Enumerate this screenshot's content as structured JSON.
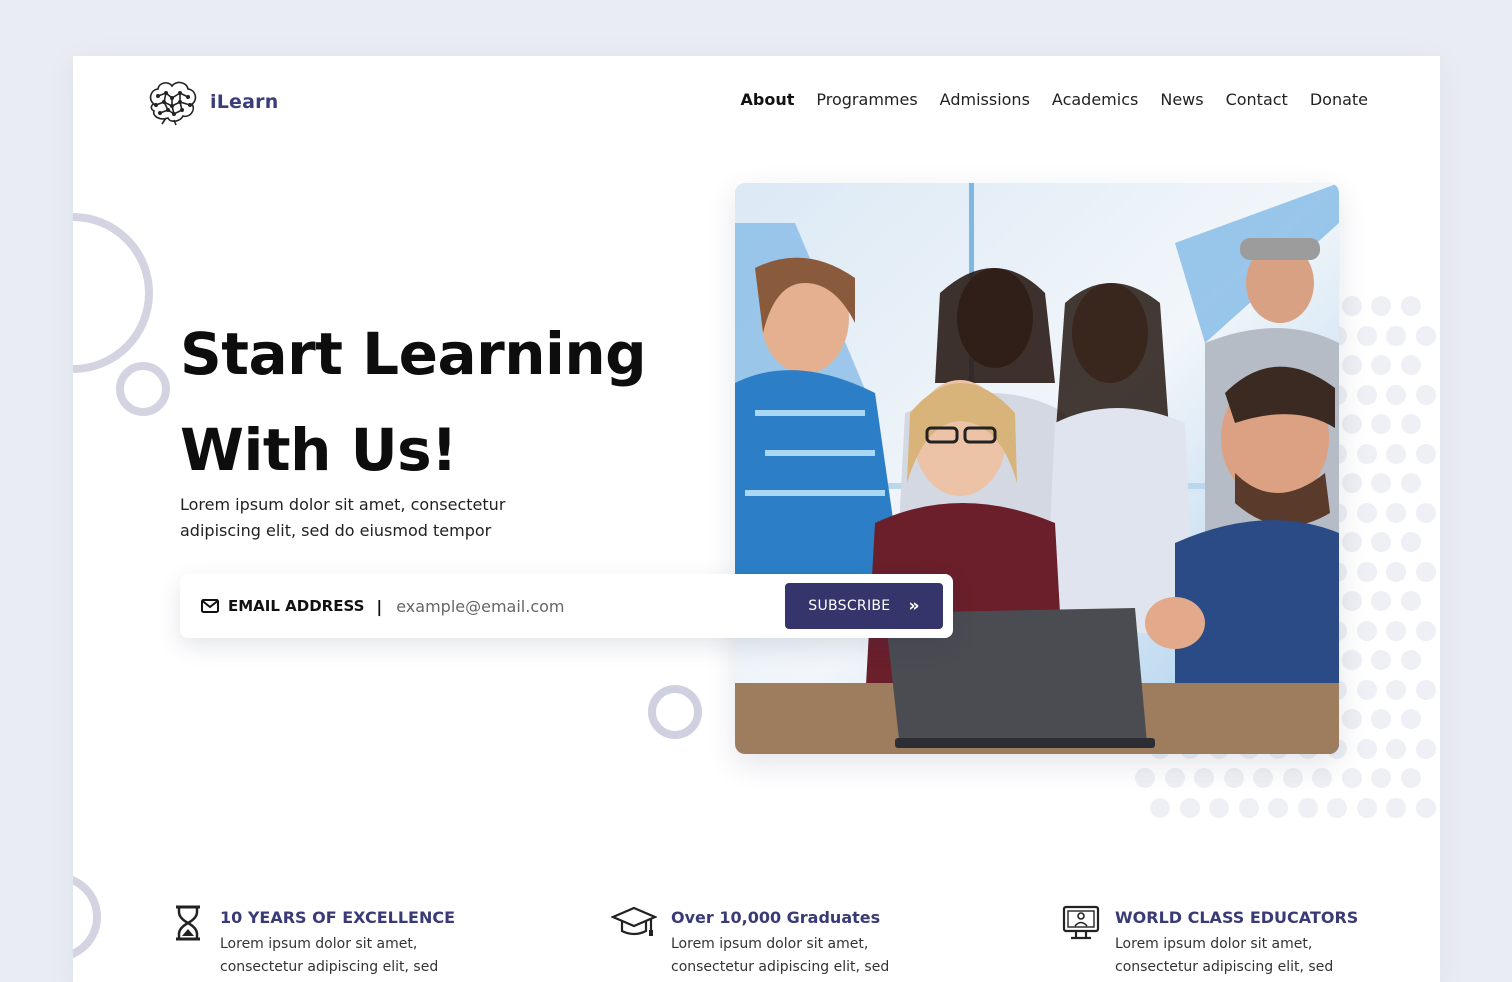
{
  "brand": {
    "name": "iLearn",
    "color": "#3b3c7a"
  },
  "nav": {
    "items": [
      {
        "label": "About",
        "active": true
      },
      {
        "label": "Programmes"
      },
      {
        "label": "Admissions"
      },
      {
        "label": "Academics"
      },
      {
        "label": "News"
      },
      {
        "label": "Contact"
      },
      {
        "label": "Donate"
      }
    ]
  },
  "hero": {
    "title_line1": "Start Learning",
    "title_line2": "With Us!",
    "subtitle": "Lorem ipsum dolor sit amet, consectetur adipiscing elit, sed do eiusmod tempor"
  },
  "subscribe": {
    "icon": "mail-icon",
    "label": "EMAIL ADDRESS",
    "separator": "|",
    "placeholder": "example@email.com",
    "button_label": "SUBSCRIBE",
    "button_icon": "double-chevron-right-icon",
    "button_color": "#35356b"
  },
  "features": [
    {
      "icon": "hourglass-icon",
      "title": "10 YEARS OF EXCELLENCE",
      "text": "Lorem ipsum dolor sit amet, consectetur adipiscing elit, sed"
    },
    {
      "icon": "graduation-cap-icon",
      "title": "Over 10,000 Graduates",
      "text": "Lorem ipsum dolor sit amet, consectetur adipiscing elit, sed"
    },
    {
      "icon": "teacher-board-icon",
      "title": "WORLD CLASS EDUCATORS",
      "text": "Lorem ipsum dolor sit amet, consectetur adipiscing elit, sed"
    }
  ]
}
